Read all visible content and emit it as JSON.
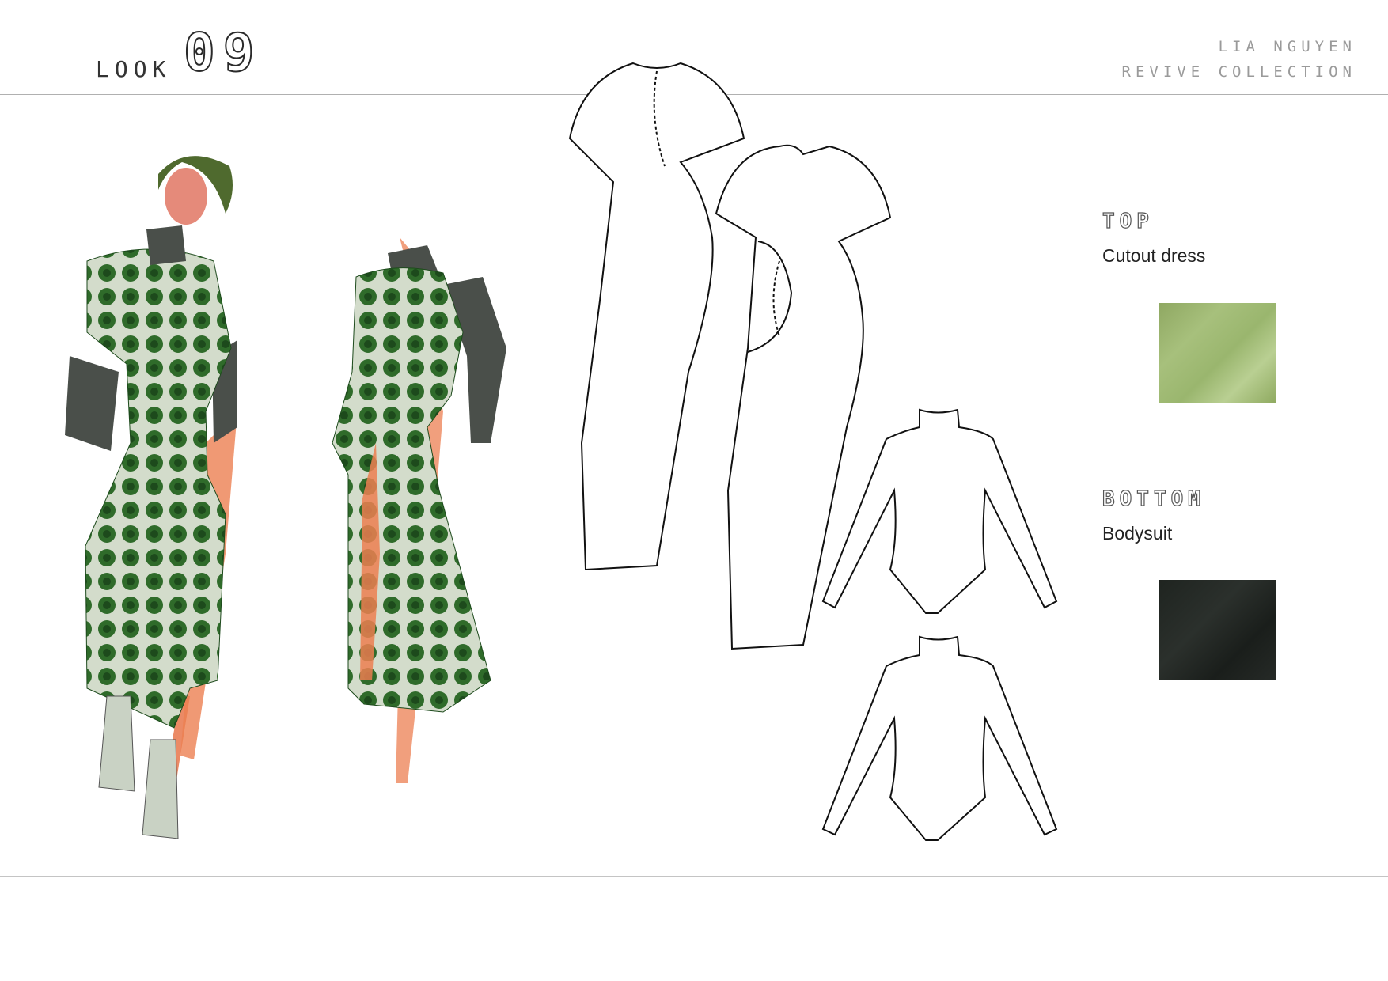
{
  "header": {
    "look_label": "LOOK",
    "look_number": "09",
    "designer": "LIA NGUYEN",
    "collection": "REVIVE COLLECTION"
  },
  "sections": {
    "top": {
      "heading": "TOP",
      "item": "Cutout dress",
      "swatch_color": "#9bb46e"
    },
    "bottom": {
      "heading": "BOTTOM",
      "item": "Bodysuit",
      "swatch_color": "#222623"
    }
  },
  "colors": {
    "print_green": "#2f6b2a",
    "print_base": "#cfd8c6",
    "skin": "#e8754a",
    "sleeve": "#4a4f4a"
  }
}
